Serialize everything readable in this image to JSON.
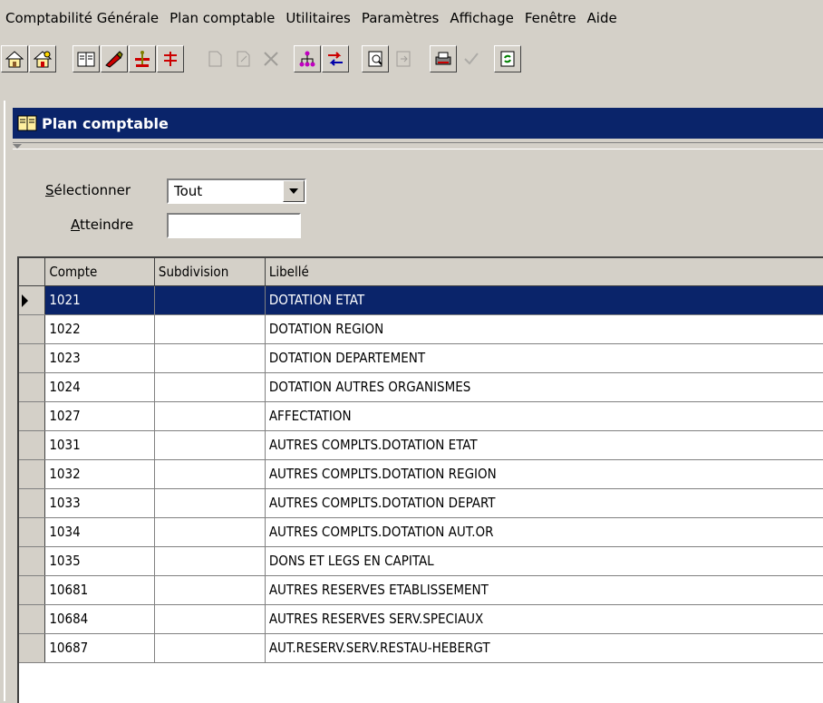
{
  "menu": [
    "Comptabilité Générale",
    "Plan comptable",
    "Utilitaires",
    "Paramètres",
    "Affichage",
    "Fenêtre",
    "Aide"
  ],
  "window": {
    "title": "Plan comptable"
  },
  "filters": {
    "select_label": "Sélectionner",
    "select_value": "Tout",
    "goto_label": "Atteindre",
    "goto_value": ""
  },
  "grid": {
    "columns": [
      "Compte",
      "Subdivision",
      "Libellé"
    ],
    "selected_index": 0,
    "rows": [
      {
        "compte": "1021",
        "subdivision": "",
        "libelle": "DOTATION ETAT"
      },
      {
        "compte": "1022",
        "subdivision": "",
        "libelle": "DOTATION REGION"
      },
      {
        "compte": "1023",
        "subdivision": "",
        "libelle": "DOTATION DEPARTEMENT"
      },
      {
        "compte": "1024",
        "subdivision": "",
        "libelle": "DOTATION AUTRES ORGANISMES"
      },
      {
        "compte": "1027",
        "subdivision": "",
        "libelle": "AFFECTATION"
      },
      {
        "compte": "1031",
        "subdivision": "",
        "libelle": "AUTRES COMPLTS.DOTATION ETAT"
      },
      {
        "compte": "1032",
        "subdivision": "",
        "libelle": "AUTRES COMPLTS.DOTATION REGION"
      },
      {
        "compte": "1033",
        "subdivision": "",
        "libelle": "AUTRES COMPLTS.DOTATION DEPART"
      },
      {
        "compte": "1034",
        "subdivision": "",
        "libelle": "AUTRES COMPLTS.DOTATION AUT.OR"
      },
      {
        "compte": "1035",
        "subdivision": "",
        "libelle": "DONS ET LEGS EN CAPITAL"
      },
      {
        "compte": "10681",
        "subdivision": "",
        "libelle": "AUTRES RESERVES ETABLISSEMENT"
      },
      {
        "compte": "10684",
        "subdivision": "",
        "libelle": "AUTRES RESERVES SERV.SPECIAUX"
      },
      {
        "compte": "10687",
        "subdivision": "",
        "libelle": "AUT.RESERV.SERV.RESTAU-HEBERGT"
      }
    ]
  },
  "colors": {
    "selection": "#0a246a",
    "face": "#d4d0c8"
  }
}
